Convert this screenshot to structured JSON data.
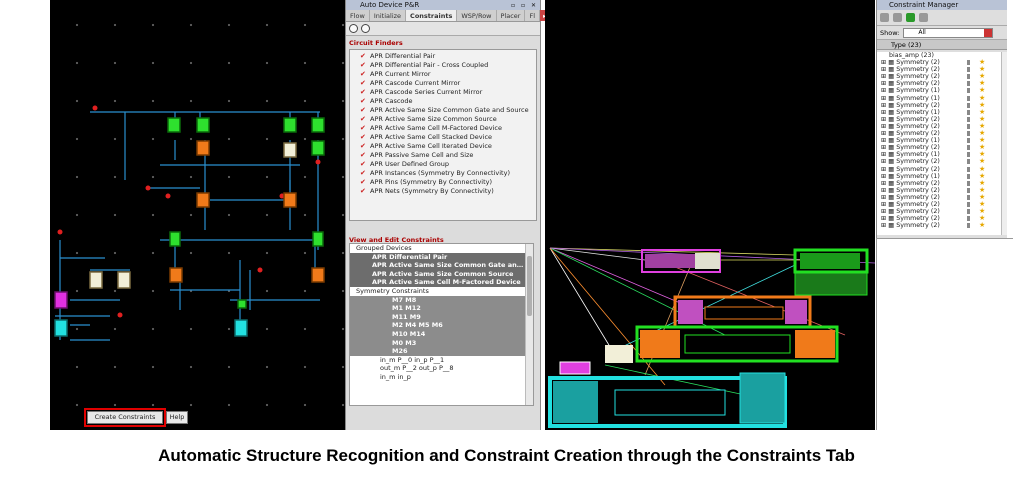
{
  "apr_window": {
    "title": "Auto Device P&R",
    "tabs": [
      "Flow",
      "Initialize",
      "Constraints",
      "WSP/Row",
      "Placer",
      "Fl"
    ],
    "active_tab": "Constraints",
    "circuit_finders_title": "Circuit Finders",
    "finders": [
      "APR Differential Pair",
      "APR Differential Pair - Cross Coupled",
      "APR Current Mirror",
      "APR Cascode Current Mirror",
      "APR Cascode Series Current Mirror",
      "APR Cascode",
      "APR Active Same Size Common Gate and Source",
      "APR Active Same Size Common Source",
      "APR Active Same Cell M-Factored Device",
      "APR Active Same Cell Stacked Device",
      "APR Active Same Cell Iterated Device",
      "APR Passive Same Cell and Size",
      "APR User Defined Group",
      "APR Instances (Symmetry By Connectivity)",
      "APR Pins (Symmetry By Connectivity)",
      "APR Nets (Symmetry By Connectivity)"
    ],
    "view_edit_title": "View and Edit Constraints",
    "tree": [
      {
        "text": "Grouped Devices",
        "style": "plain"
      },
      {
        "text": "APR Differential Pair",
        "style": "hl"
      },
      {
        "text": "APR Active Same Size Common Gate an…",
        "style": "hl"
      },
      {
        "text": "APR Active Same Size Common Source",
        "style": "hl"
      },
      {
        "text": "APR Active Same Cell M-Factored Device",
        "style": "hl"
      },
      {
        "text": "Symmetry Constraints",
        "style": "plain"
      },
      {
        "text": "M7 M8",
        "style": "sel"
      },
      {
        "text": "M1 M12",
        "style": "sel"
      },
      {
        "text": "M11 M9",
        "style": "sel"
      },
      {
        "text": "M2 M4 M5 M6",
        "style": "sel"
      },
      {
        "text": "M10 M14",
        "style": "sel"
      },
      {
        "text": "M0 M3",
        "style": "sel"
      },
      {
        "text": "M26",
        "style": "sel"
      },
      {
        "text": "in_m P__0 in_p P__1",
        "style": "plain"
      },
      {
        "text": "out_m P__2 out_p P__8",
        "style": "plain"
      },
      {
        "text": "in_m in_p",
        "style": "plain"
      }
    ],
    "create_button": "Create Constraints",
    "help_button": "Help"
  },
  "constraint_manager": {
    "title": "Constraint Manager",
    "show_label": "Show:",
    "show_value": "All",
    "column_type": "Type (23)",
    "root": "bias_amp (23)",
    "rows": [
      "Symmetry (2)",
      "Symmetry (2)",
      "Symmetry (2)",
      "Symmetry (2)",
      "Symmetry (1)",
      "Symmetry (1)",
      "Symmetry (2)",
      "Symmetry (1)",
      "Symmetry (2)",
      "Symmetry (2)",
      "Symmetry (2)",
      "Symmetry (1)",
      "Symmetry (2)",
      "Symmetry (1)",
      "Symmetry (2)",
      "Symmetry (2)",
      "Symmetry (1)",
      "Symmetry (2)",
      "Symmetry (2)",
      "Symmetry (2)",
      "Symmetry (2)",
      "Symmetry (2)",
      "Symmetry (2)",
      "Symmetry (2)"
    ]
  },
  "caption": "Automatic Structure Recognition and Constraint Creation through the Constraints Tab",
  "colors": {
    "highlight_frame": "#e00000",
    "device_green": "#22e022",
    "device_orange": "#f07a1a",
    "device_cyan": "#22e0e0",
    "device_magenta": "#e030e0",
    "wire_blue": "#2aa0e0"
  }
}
